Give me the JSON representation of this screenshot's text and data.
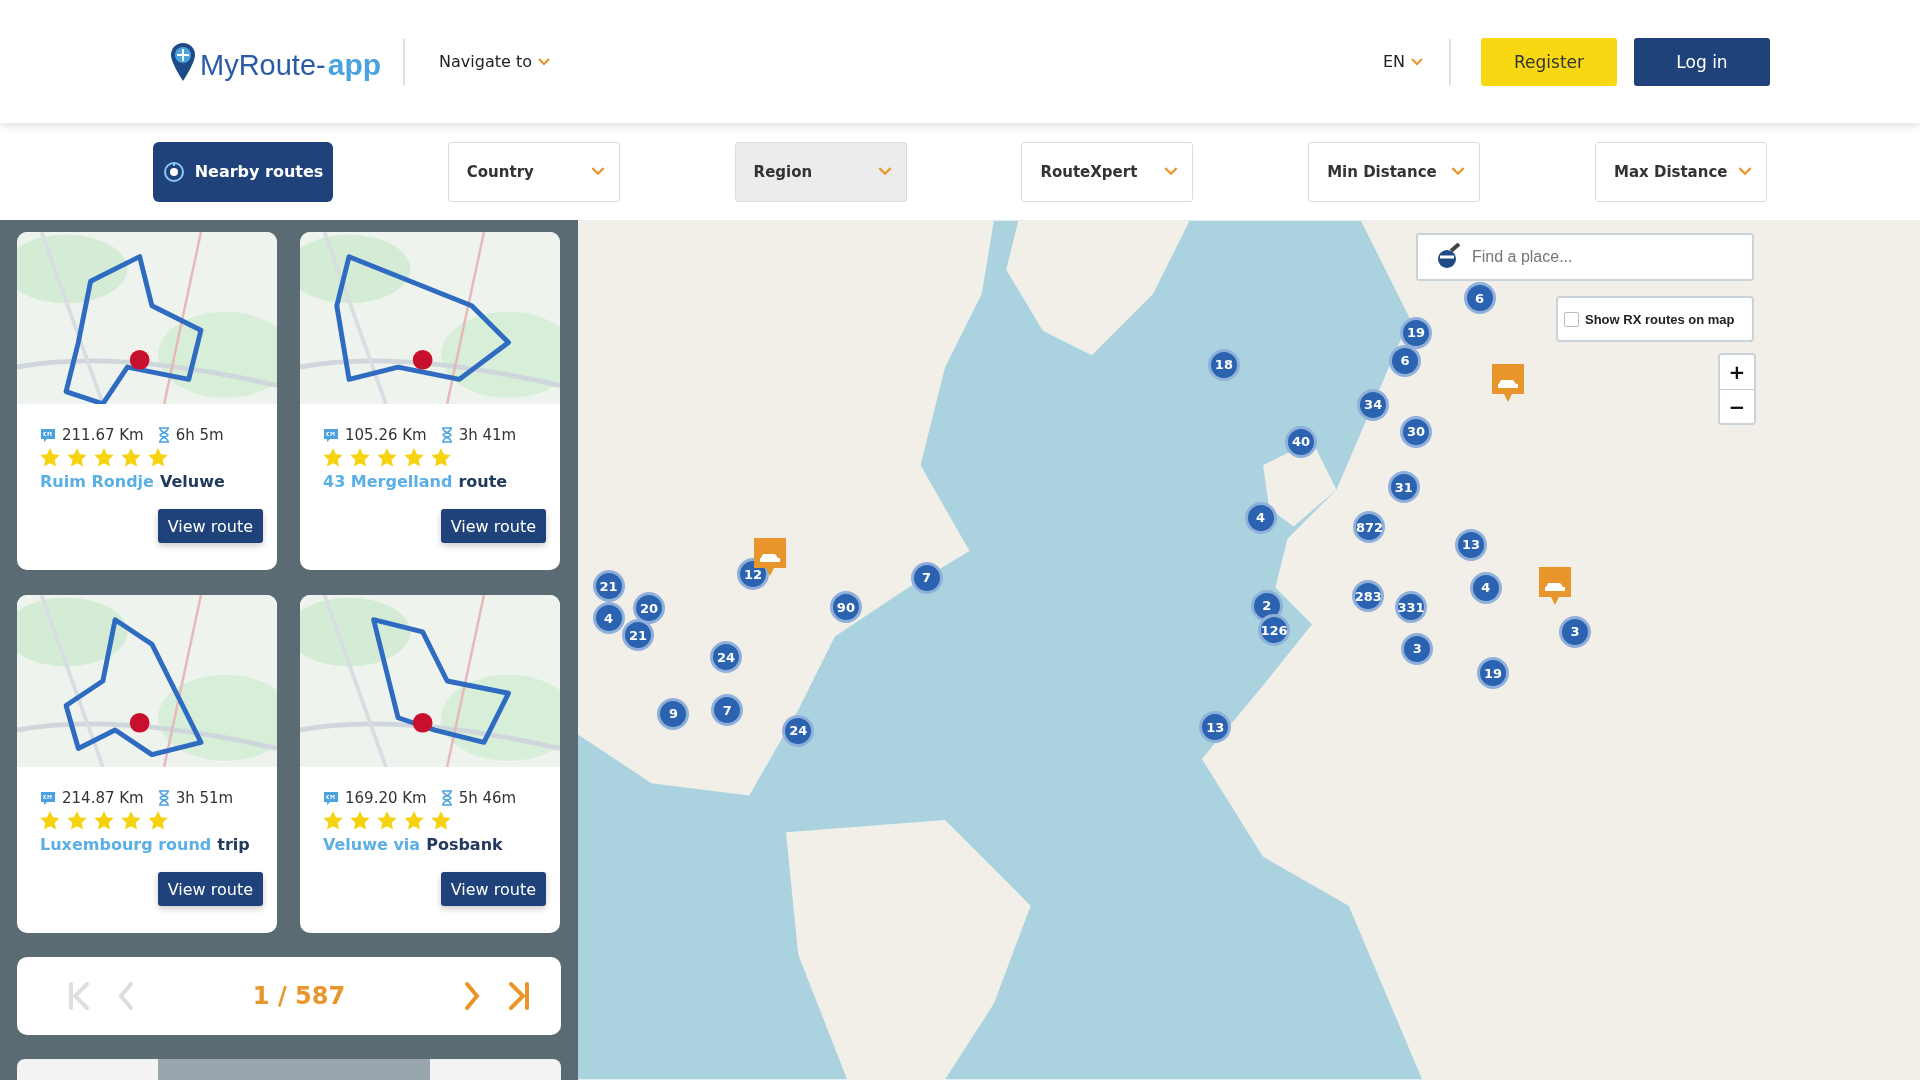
{
  "header": {
    "logo": {
      "text": "MyRoute-",
      "suffix": "app"
    },
    "nav": {
      "label": "Navigate to"
    },
    "language": "EN",
    "buttons": [
      {
        "kind": "register",
        "label": "Register"
      },
      {
        "kind": "login",
        "label": "Log in"
      }
    ]
  },
  "filters": [
    {
      "kind": "nearby",
      "label": "Nearby routes",
      "disabled": false
    },
    {
      "kind": "dropdown",
      "label": "Country",
      "disabled": false
    },
    {
      "kind": "dropdown",
      "label": "Region",
      "disabled": true
    },
    {
      "kind": "dropdown",
      "label": "RouteXpert",
      "disabled": false
    },
    {
      "kind": "dropdown",
      "label": "Min Distance",
      "disabled": false
    },
    {
      "kind": "dropdown",
      "label": "Max Distance",
      "disabled": false
    }
  ],
  "routes": [
    {
      "distance": "211.67 Km",
      "duration": "6h 5m",
      "stars": 5,
      "title_highlight": "Ruim Rondje",
      "title_rest": "Veluwe",
      "button": "View route"
    },
    {
      "distance": "105.26 Km",
      "duration": "3h 41m",
      "stars": 5,
      "title_highlight": "43 Mergelland",
      "title_rest": "route",
      "button": "View route"
    },
    {
      "distance": "214.87 Km",
      "duration": "3h 51m",
      "stars": 5,
      "title_highlight": "Luxembourg round",
      "title_rest": "trip",
      "button": "View route"
    },
    {
      "distance": "169.20 Km",
      "duration": "5h 46m",
      "stars": 5,
      "title_highlight": "Veluwe via",
      "title_rest": "Posbank",
      "button": "View route"
    }
  ],
  "pagination": {
    "page": "1 / 587",
    "controls": [
      {
        "kind": "first",
        "disabled": true
      },
      {
        "kind": "prev",
        "disabled": true
      },
      {
        "kind": "next",
        "disabled": false
      },
      {
        "kind": "last",
        "disabled": false
      }
    ]
  },
  "map": {
    "search": {
      "placeholder": "Find a place..."
    },
    "rx_toggle": {
      "label": "Show RX routes on map",
      "checked": false
    },
    "zoom": [
      "+",
      "−"
    ],
    "clusters": [
      "6",
      "19",
      "6",
      "18",
      "34",
      "30",
      "40",
      "31",
      "4",
      "872",
      "13",
      "4",
      "2",
      "283",
      "331",
      "126",
      "3",
      "19",
      "3",
      "13",
      "21",
      "20",
      "4",
      "21",
      "12",
      "90",
      "7",
      "24",
      "9",
      "7",
      "24"
    ],
    "pois": [
      {
        "kind": "car"
      },
      {
        "kind": "car"
      },
      {
        "kind": "car"
      }
    ]
  }
}
